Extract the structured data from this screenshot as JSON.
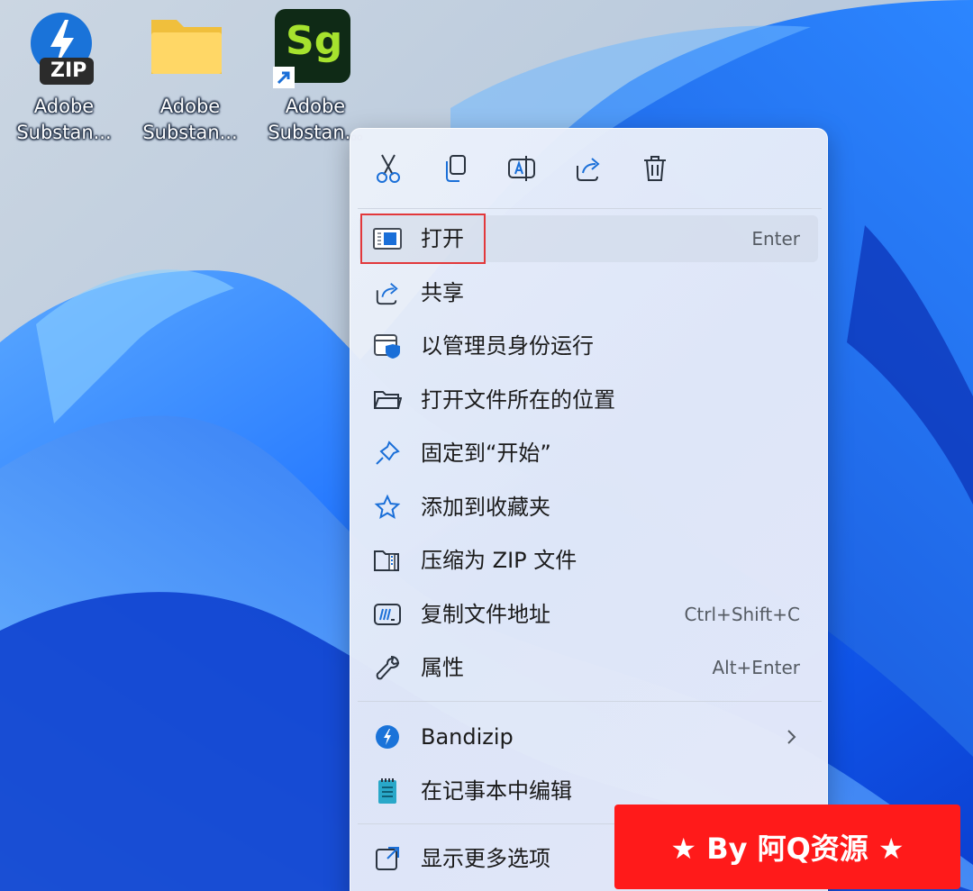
{
  "desktop": {
    "icons": [
      {
        "name": "zip-archive",
        "line1": "Adobe",
        "line2": "Substan...",
        "badge": "ZIP"
      },
      {
        "name": "folder",
        "line1": "Adobe",
        "line2": "Substan..."
      },
      {
        "name": "substance-designer-shortcut",
        "line1": "Adobe",
        "line2": "Substan...",
        "app_mark": "Sg"
      }
    ]
  },
  "context_menu": {
    "toolbar": [
      {
        "icon": "cut-icon",
        "action": "cut"
      },
      {
        "icon": "copy-icon",
        "action": "copy"
      },
      {
        "icon": "rename-icon",
        "action": "rename"
      },
      {
        "icon": "share-icon",
        "action": "share"
      },
      {
        "icon": "delete-icon",
        "action": "delete"
      }
    ],
    "items": [
      {
        "label": "打开",
        "shortcut": "Enter",
        "icon": "open-window-icon"
      },
      {
        "label": "共享",
        "icon": "share-icon"
      },
      {
        "label": "以管理员身份运行",
        "icon": "admin-shield-icon"
      },
      {
        "label": "打开文件所在的位置",
        "icon": "folder-open-icon"
      },
      {
        "label": "固定到“开始”",
        "icon": "pin-icon"
      },
      {
        "label": "添加到收藏夹",
        "icon": "star-icon"
      },
      {
        "label": "压缩为 ZIP 文件",
        "icon": "zip-folder-icon"
      },
      {
        "label": "复制文件地址",
        "shortcut": "Ctrl+Shift+C",
        "icon": "copy-path-icon"
      },
      {
        "label": "属性",
        "shortcut": "Alt+Enter",
        "icon": "wrench-icon"
      }
    ],
    "extra_items": [
      {
        "label": "Bandizip",
        "icon": "bandizip-icon",
        "has_submenu": true
      },
      {
        "label": "在记事本中编辑",
        "icon": "notepad-icon"
      }
    ],
    "more_options": {
      "label": "显示更多选项",
      "icon": "more-options-icon"
    }
  },
  "watermark": {
    "text": "★ By 阿Q资源 ★"
  },
  "colors": {
    "accent": "#0067c0",
    "highlight_border": "#e2383b",
    "watermark_bg": "#ff1a1a",
    "substance_green": "#a6e22e",
    "substance_bg": "#0f2a16"
  }
}
